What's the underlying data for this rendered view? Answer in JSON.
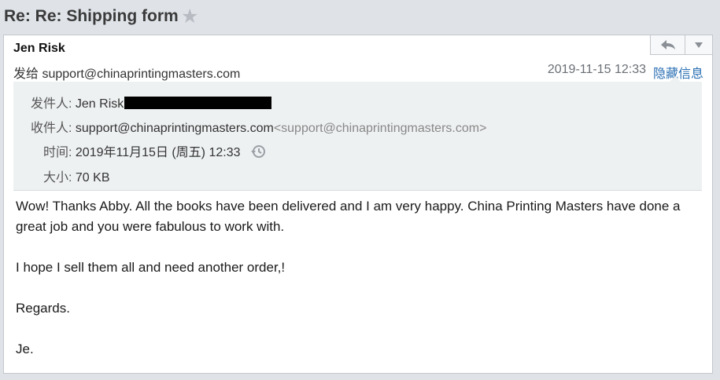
{
  "subject": "Re: Re: Shipping form",
  "star_icon": "star-icon",
  "header": {
    "sender_name": "Jen Risk",
    "sendto_label": "发给",
    "sendto_value": "support@chinaprintingmasters.com",
    "date": "2019-11-15 12:33",
    "hide_info": "隐藏信息",
    "reply_icon": "reply-icon",
    "more_icon": "chevron-down-icon"
  },
  "details": {
    "from_label": "发件人:",
    "from_value": "Jen Risk",
    "to_label": "收件人:",
    "to_value": "support@chinaprintingmasters.com",
    "to_sub": "<support@chinaprintingmasters.com>",
    "time_label": "时间:",
    "time_value": "2019年11月15日 (周五) 12:33",
    "size_label": "大小:",
    "size_value": "70 KB"
  },
  "body": {
    "para1": "Wow! Thanks Abby. All the books have been delivered and I am very happy. China Printing Masters have done a great job and you were fabulous to work with.",
    "para2": "I hope I sell them all and need another order,!",
    "para3": "Regards.",
    "para4": "Je."
  }
}
